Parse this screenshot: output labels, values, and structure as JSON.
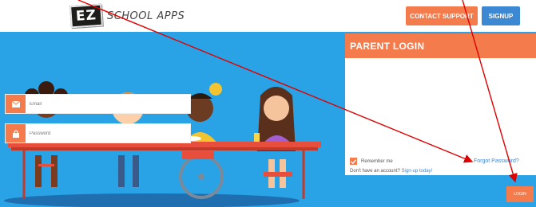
{
  "header": {
    "logo_mark": "EZ",
    "logo_text": "SCHOOL APPS",
    "contact_label": "CONTACT SUPPORT",
    "signup_label": "SIGNUP"
  },
  "login": {
    "title": "PARENT LOGIN",
    "email_placeholder": "Email",
    "password_placeholder": "Password",
    "remember_label": "Remember me",
    "forgot_label": "Forgot Password?",
    "no_account_text": "Don't have an account?",
    "signup_link": "Sign-up today!",
    "login_label": "LOGIN",
    "remember_checked": true
  },
  "colors": {
    "accent": "#f47b4b",
    "blue": "#3d88d2",
    "hero_bg": "#2aa3e6",
    "annotation": "#e00000"
  },
  "icons": {
    "email": "envelope-icon",
    "password": "lock-icon",
    "checkbox": "checkmark-icon"
  }
}
